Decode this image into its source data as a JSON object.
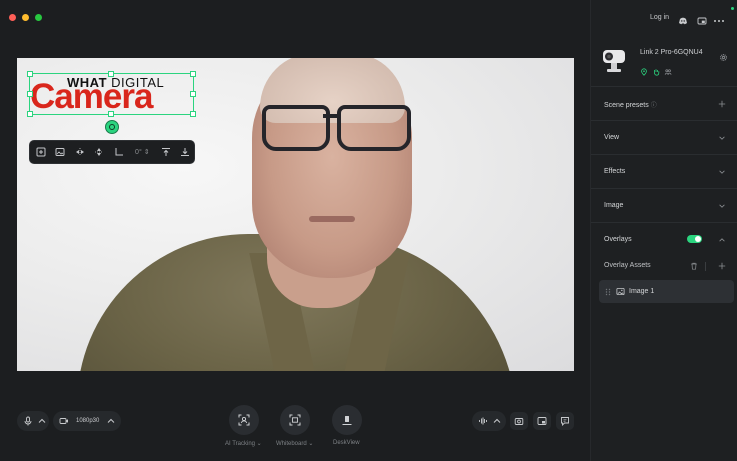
{
  "window": {
    "traffic_lights": [
      "close",
      "minimize",
      "zoom"
    ]
  },
  "overlay": {
    "logo_top_bold": "WHAT",
    "logo_top_regular": "DIGITAL",
    "logo_main": "Camera",
    "toolbar_angle": "0°"
  },
  "bottom_bar": {
    "resolution": "1080p30",
    "ai_tracking_label": "AI Tracking",
    "whiteboard_label": "Whiteboard",
    "deskview_label": "DeskView"
  },
  "sidebar": {
    "login_label": "Log in",
    "device_name": "Link 2 Pro-6GQNU4",
    "sections": [
      {
        "label": "Scene presets"
      },
      {
        "label": "View"
      },
      {
        "label": "Effects"
      },
      {
        "label": "Image"
      },
      {
        "label": "Overlays"
      }
    ],
    "overlays_enabled": true,
    "overlay_assets_label": "Overlay Assets",
    "asset_item_label": "Image 1"
  },
  "colors": {
    "accent": "#2bd47f",
    "logo_red": "#d9261c"
  }
}
